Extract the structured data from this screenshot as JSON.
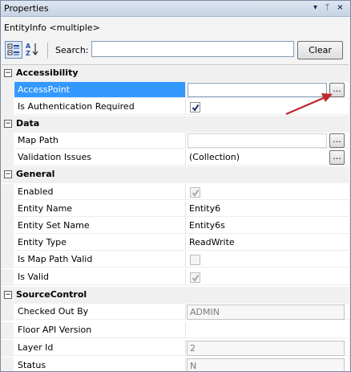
{
  "window": {
    "title": "Properties",
    "selected_object": "EntityInfo <multiple>"
  },
  "titlebar_icons": [
    "dropdown-icon",
    "pin-icon",
    "close-icon"
  ],
  "toolbar": {
    "categorized_icon": "categorized-icon",
    "alphabetical_icon": "alphabetical-icon",
    "search_label": "Search:",
    "search_value": "",
    "clear_label": "Clear"
  },
  "grid": {
    "accessibility": {
      "title": "Accessibility",
      "rows": [
        {
          "name": "AccessPoint",
          "value": "",
          "editor": "text-with-ellipsis",
          "selected": true
        },
        {
          "name": "Is Authentication Required",
          "checked": true,
          "editor": "checkbox"
        }
      ]
    },
    "data": {
      "title": "Data",
      "rows": [
        {
          "name": "Map Path",
          "value": "",
          "editor": "text-with-ellipsis"
        },
        {
          "name": "Validation Issues",
          "value": "(Collection)",
          "editor": "ellipsis"
        }
      ]
    },
    "general": {
      "title": "General",
      "rows": [
        {
          "name": "Enabled",
          "checked": true,
          "disabled": true
        },
        {
          "name": "Entity Name",
          "value": "Entity6"
        },
        {
          "name": "Entity Set Name",
          "value": "Entity6s"
        },
        {
          "name": "Entity Type",
          "value": "ReadWrite"
        },
        {
          "name": "Is Map Path Valid",
          "checked": false,
          "disabled": true
        },
        {
          "name": "Is Valid",
          "checked": true,
          "disabled": true
        }
      ]
    },
    "source_control": {
      "title": "SourceControl",
      "rows": [
        {
          "name": "Checked Out By",
          "value": "ADMIN",
          "readonly": true
        },
        {
          "name": "Floor API Version",
          "value": ""
        },
        {
          "name": "Layer Id",
          "value": "2",
          "readonly": true
        },
        {
          "name": "Status",
          "value": "N",
          "readonly": true
        }
      ]
    }
  },
  "colors": {
    "selection": "#3399ff",
    "annotation_arrow": "#c0262d"
  },
  "ellipsis_label": "..."
}
